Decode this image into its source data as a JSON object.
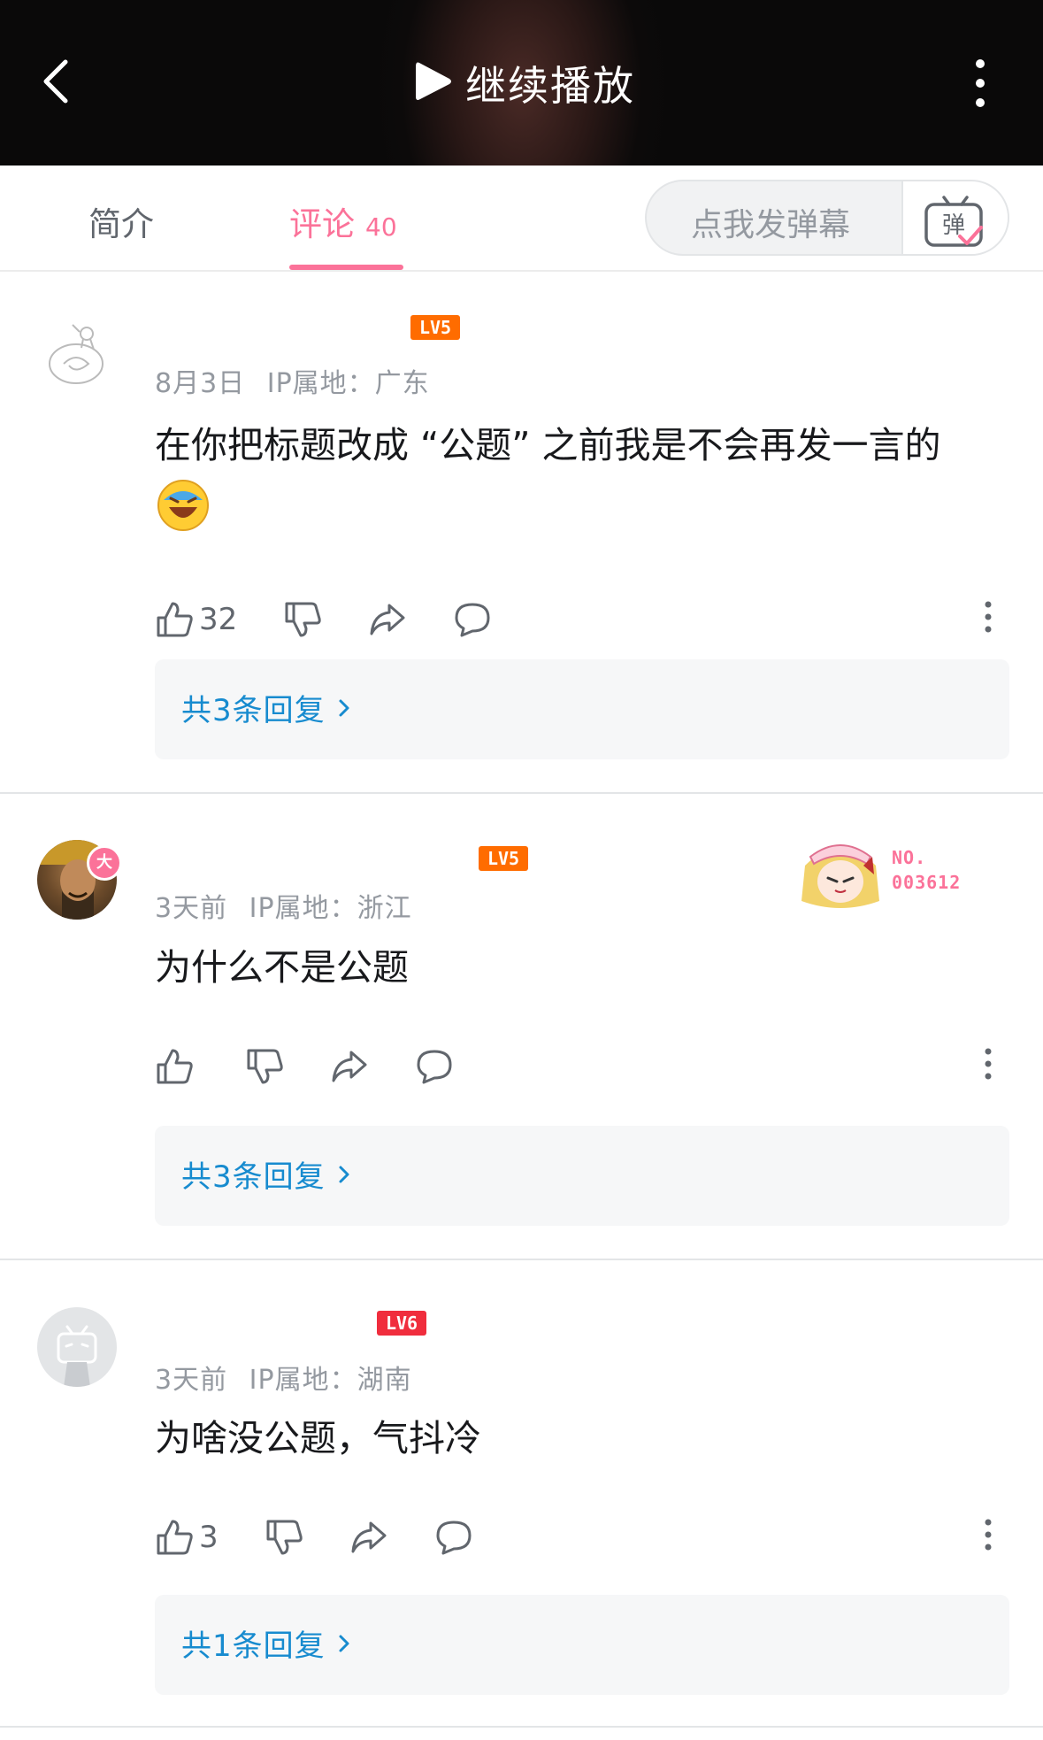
{
  "header": {
    "continue_play_label": "继续播放"
  },
  "tabs": {
    "intro_label": "简介",
    "comments_label": "评论",
    "comments_count": "40"
  },
  "danmu": {
    "placeholder": "点我发弹幕",
    "button_glyph": "弹"
  },
  "comments": [
    {
      "level": "LV5",
      "level_color": "#ff6c00",
      "date": "8月3日",
      "ip": "IP属地：广东",
      "text": "在你把标题改成 “公题” 之前我是不会再发一言的",
      "likes": "32",
      "replies_label": "共3条回复"
    },
    {
      "level": "LV5",
      "level_color": "#ff6c00",
      "date": "3天前",
      "ip": "IP属地：浙江",
      "text": "为什么不是公题",
      "likes": "",
      "avatar_badge": "大",
      "fan_badge_no_label": "NO.",
      "fan_badge_no": "003612",
      "replies_label": "共3条回复"
    },
    {
      "level": "LV6",
      "level_color": "#f02d3d",
      "date": "3天前",
      "ip": "IP属地：湖南",
      "text": "为啥没公题，气抖冷",
      "likes": "3",
      "replies_label": "共1条回复"
    }
  ],
  "colors": {
    "accent": "#fb7299",
    "link": "#178bcf",
    "meta": "#9499a0"
  }
}
